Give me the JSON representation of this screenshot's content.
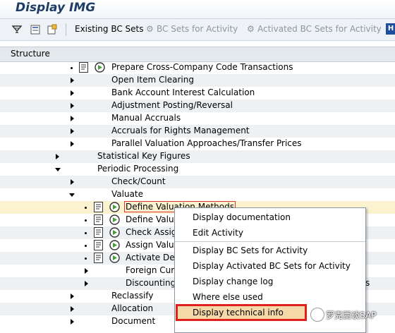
{
  "window": {
    "title": "Display IMG"
  },
  "toolbar": {
    "existing_bc_sets": "Existing BC Sets",
    "bc_sets_for_activity": "BC Sets for Activity",
    "activated_bc_sets_for_activity": "Activated BC Sets for Activity",
    "help_label": "H"
  },
  "structure": {
    "header": "Structure"
  },
  "tree": [
    {
      "label": "Prepare Cross-Company Code Transactions"
    },
    {
      "label": "Open Item Clearing"
    },
    {
      "label": "Bank Account Interest Calculation"
    },
    {
      "label": "Adjustment Posting/Reversal"
    },
    {
      "label": "Manual Accruals"
    },
    {
      "label": "Accruals for Rights Management"
    },
    {
      "label": "Parallel Valuation Approaches/Transfer Prices"
    },
    {
      "label": "Statistical Key Figures"
    },
    {
      "label": "Periodic Processing"
    },
    {
      "label": "Check/Count"
    },
    {
      "label": "Valuate"
    },
    {
      "label": "Define Valuation Methods"
    },
    {
      "label": "Define Valua"
    },
    {
      "label": "Check Assign"
    },
    {
      "label": "Assign Valua"
    },
    {
      "label": "Activate Del"
    },
    {
      "label": "Foreign Curr"
    },
    {
      "label": "Discounting"
    },
    {
      "label": "Reclassify"
    },
    {
      "label": "Allocation"
    },
    {
      "label": "Document"
    }
  ],
  "tree_overflow_fragment": "s",
  "context_menu": {
    "items": [
      {
        "label": "Display documentation"
      },
      {
        "label": "Edit Activity"
      },
      {
        "label": "Display BC Sets for Activity"
      },
      {
        "label": "Display Activated BC Sets for Activity"
      },
      {
        "label": "Display change log"
      },
      {
        "label": "Where else used"
      },
      {
        "label": "Display technical info"
      }
    ]
  },
  "watermark": {
    "text": "罗克西谈SAP"
  },
  "colors": {
    "title": "#1e3d66",
    "selection_row": "#fbf2cf",
    "highlight_border": "#e0201a",
    "menu_hover": "#f6d9a8"
  }
}
